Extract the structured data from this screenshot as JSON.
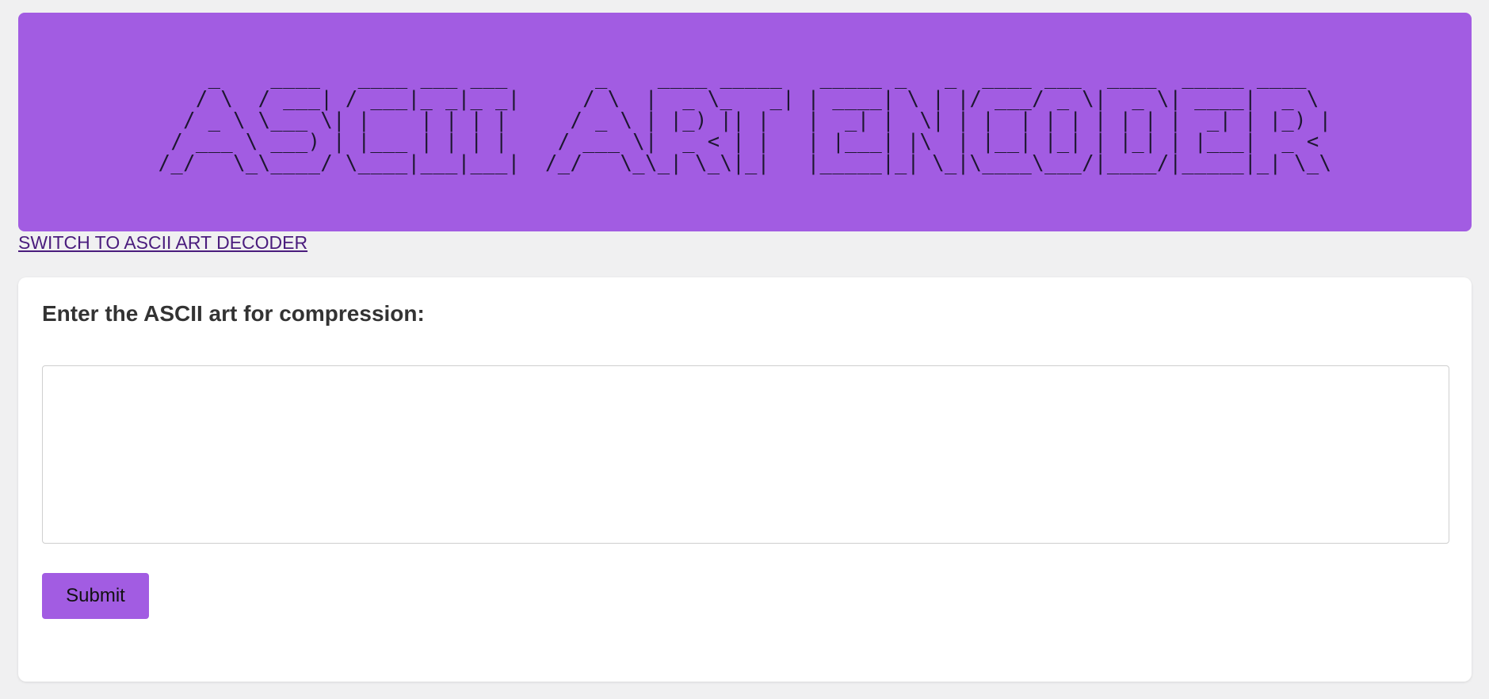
{
  "header": {
    "ascii_title": "    _    ____   ____ ___ ___       _    ____ _____   _____ _   _  ____ ___  ____  _____ ____  \n   / \\  / ___| / ___|_ _|_ _|     / \\  |  _ \\_   _| | ____| \\ | |/ ___/ _ \\|  _ \\| ____|  _ \\ \n  / _ \\ \\___ \\| |    | | | |     / _ \\ | |_) || |   |  _| |  \\| | |  | | | | | | |  _| | |_) |\n / ___ \\ ___) | |___ | | | |    / ___ \\|  _ < | |   | |___| |\\  | |__| |_| | |_| | |___|  _ < \n/_/   \\_\\____/ \\____|___|___|  /_/   \\_\\_| \\_\\|_|   |_____|_| \\_|\\____\\___/|____/|_____|_| \\_\\",
    "switch_link": "SWITCH TO ASCII ART DECODER"
  },
  "form": {
    "heading": "Enter the ASCII art for compression:",
    "textarea_value": "",
    "textarea_placeholder": "",
    "submit_label": "Submit"
  },
  "colors": {
    "background": "#f0f0f1",
    "accent": "#a25ce2",
    "link": "#4a1c7d",
    "card": "#ffffff",
    "text": "#333333"
  }
}
